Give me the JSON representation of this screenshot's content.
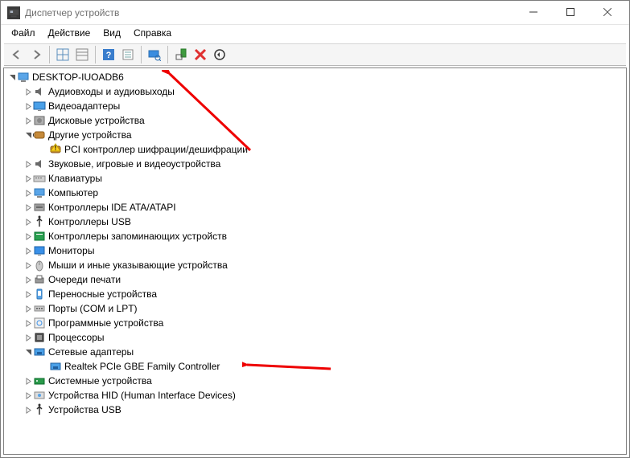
{
  "titlebar": {
    "title": "Диспетчер устройств"
  },
  "menu": {
    "file": "Файл",
    "action": "Действие",
    "view": "Вид",
    "help": "Справка"
  },
  "tree": {
    "root": "DESKTOP-IUOADB6",
    "nodes": [
      {
        "label": "Аудиовходы и аудиовыходы",
        "icon": "audio",
        "exp": false
      },
      {
        "label": "Видеоадаптеры",
        "icon": "display",
        "exp": false
      },
      {
        "label": "Дисковые устройства",
        "icon": "disk",
        "exp": false
      },
      {
        "label": "Другие устройства",
        "icon": "other",
        "exp": true,
        "children": [
          {
            "label": "PCI контроллер шифрации/дешифрации",
            "icon": "warn-other"
          }
        ]
      },
      {
        "label": "Звуковые, игровые и видеоустройства",
        "icon": "audio",
        "exp": false
      },
      {
        "label": "Клавиатуры",
        "icon": "keyboard",
        "exp": false
      },
      {
        "label": "Компьютер",
        "icon": "computer",
        "exp": false
      },
      {
        "label": "Контроллеры IDE ATA/ATAPI",
        "icon": "ide",
        "exp": false
      },
      {
        "label": "Контроллеры USB",
        "icon": "usb",
        "exp": false
      },
      {
        "label": "Контроллеры запоминающих устройств",
        "icon": "storage",
        "exp": false
      },
      {
        "label": "Мониторы",
        "icon": "monitor",
        "exp": false
      },
      {
        "label": "Мыши и иные указывающие устройства",
        "icon": "mouse",
        "exp": false
      },
      {
        "label": "Очереди печати",
        "icon": "printer",
        "exp": false
      },
      {
        "label": "Переносные устройства",
        "icon": "portable",
        "exp": false
      },
      {
        "label": "Порты (COM и LPT)",
        "icon": "port",
        "exp": false
      },
      {
        "label": "Программные устройства",
        "icon": "soft",
        "exp": false
      },
      {
        "label": "Процессоры",
        "icon": "cpu",
        "exp": false
      },
      {
        "label": "Сетевые адаптеры",
        "icon": "network",
        "exp": true,
        "children": [
          {
            "label": "Realtek PCIe GBE Family Controller",
            "icon": "network"
          }
        ]
      },
      {
        "label": "Системные устройства",
        "icon": "system",
        "exp": false
      },
      {
        "label": "Устройства HID (Human Interface Devices)",
        "icon": "hid",
        "exp": false
      },
      {
        "label": "Устройства USB",
        "icon": "usb",
        "exp": false
      }
    ]
  }
}
